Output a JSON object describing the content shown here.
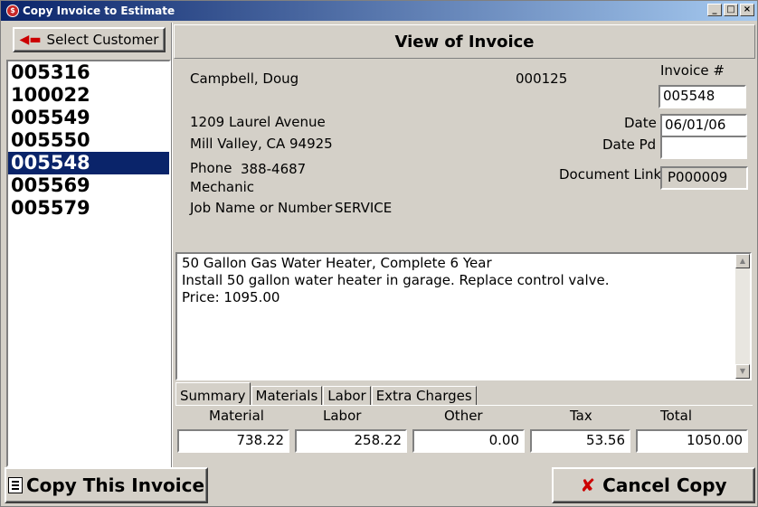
{
  "window": {
    "title": "Copy Invoice to Estimate"
  },
  "left_panel": {
    "select_customer_label": "Select Customer",
    "invoices": [
      "005316",
      "100022",
      "005549",
      "005550",
      "005548",
      "005569",
      "005579"
    ],
    "selected_index": 4
  },
  "header": {
    "title": "View of Invoice"
  },
  "customer": {
    "name": "Campbell, Doug",
    "customer_number": "000125",
    "address_line1": "1209 Laurel Avenue",
    "address_line2": "Mill Valley, CA  94925",
    "phone_label": "Phone",
    "phone": "388-4687",
    "occupation": "Mechanic",
    "job_label": "Job Name or Number",
    "job": "SERVICE"
  },
  "invoice": {
    "number_label": "Invoice #",
    "number": "005548",
    "date_label": "Date",
    "date": "06/01/06",
    "date_paid_label": "Date Pd",
    "date_paid": "",
    "doc_link_label": "Document Link",
    "doc_link": "P000009"
  },
  "memo_lines": [
    "50 Gallon Gas Water Heater, Complete 6 Year",
    "Install 50 gallon water heater in garage. Replace control valve.",
    "Price: 1095.00"
  ],
  "tabs": [
    "Summary",
    "Materials",
    "Labor",
    "Extra Charges"
  ],
  "summary": {
    "labels": {
      "material": "Material",
      "labor": "Labor",
      "other": "Other",
      "tax": "Tax",
      "total": "Total"
    },
    "values": {
      "material": "738.22",
      "labor": "258.22",
      "other": "0.00",
      "tax": "53.56",
      "total": "1050.00"
    }
  },
  "buttons": {
    "copy": "Copy This Invoice",
    "cancel": "Cancel Copy"
  },
  "colors": {
    "selection": "#0a246a",
    "cancel_icon": "#cc0000"
  }
}
